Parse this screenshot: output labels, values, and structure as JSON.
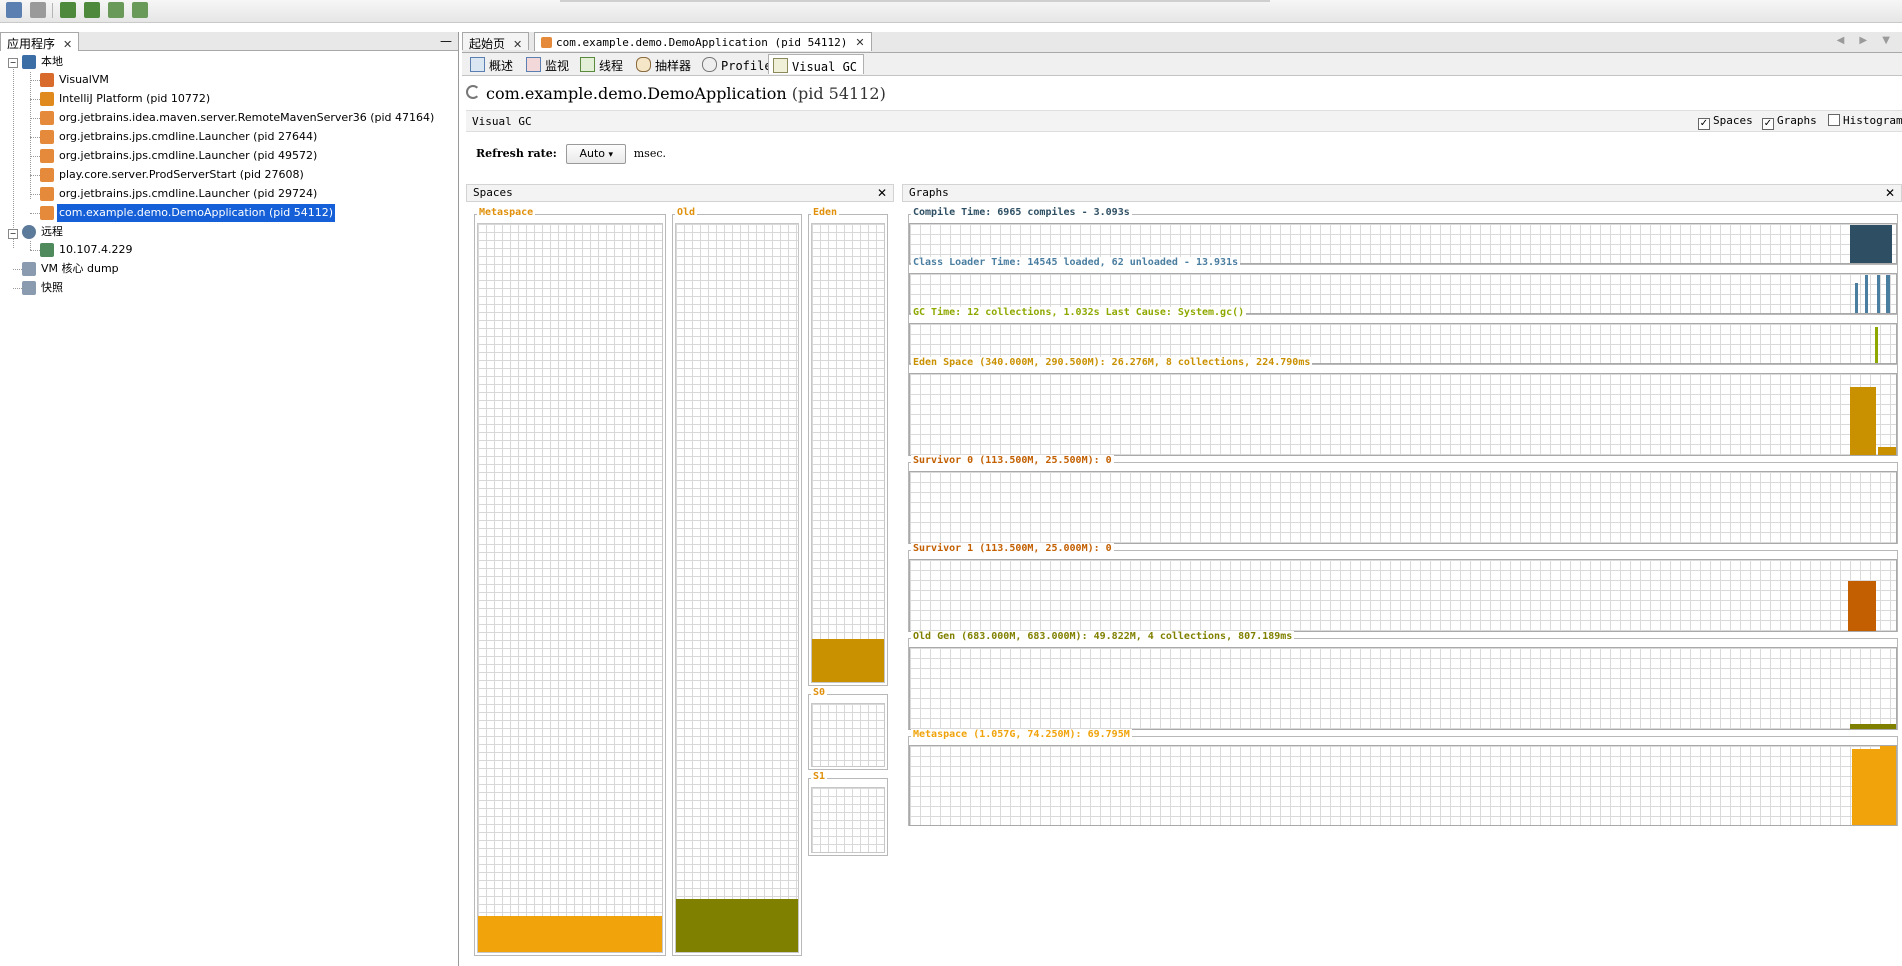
{
  "toolbar": {
    "buttons": [
      "open-snapshot-icon",
      "save-icon",
      "add-jmx-icon",
      "add-remote-host-icon",
      "add-coredump-icon",
      "load-snapshot-icon"
    ]
  },
  "left_panel": {
    "tab_label": "应用程序",
    "tree": {
      "local": {
        "label": "本地",
        "items": [
          {
            "label": "VisualVM",
            "icon": "visualvm-icon"
          },
          {
            "label": "IntelliJ Platform (pid 10772)",
            "icon": "intellij-icon"
          },
          {
            "label": "org.jetbrains.idea.maven.server.RemoteMavenServer36 (pid 47164)",
            "icon": "java-icon"
          },
          {
            "label": "org.jetbrains.jps.cmdline.Launcher (pid 27644)",
            "icon": "java-icon"
          },
          {
            "label": "org.jetbrains.jps.cmdline.Launcher (pid 49572)",
            "icon": "java-icon"
          },
          {
            "label": "play.core.server.ProdServerStart (pid 27608)",
            "icon": "java-icon"
          },
          {
            "label": "org.jetbrains.jps.cmdline.Launcher (pid 29724)",
            "icon": "java-icon"
          },
          {
            "label": "com.example.demo.DemoApplication (pid 54112)",
            "icon": "java-icon",
            "selected": true
          }
        ]
      },
      "remote": {
        "label": "远程",
        "items": [
          {
            "label": "10.107.4.229",
            "icon": "remote-host-icon"
          }
        ]
      },
      "coredump": {
        "label": "VM 核心 dump"
      },
      "snapshots": {
        "label": "快照"
      }
    }
  },
  "right_panel": {
    "tabs": [
      {
        "label": "起始页"
      },
      {
        "label": "com.example.demo.DemoApplication (pid 54112)",
        "active": true
      }
    ],
    "subtabs": [
      {
        "label": "概述",
        "icon": "overview-icon"
      },
      {
        "label": "监视",
        "icon": "monitor-icon"
      },
      {
        "label": "线程",
        "icon": "threads-icon"
      },
      {
        "label": "抽样器",
        "icon": "sampler-icon"
      },
      {
        "label": "Profiler",
        "icon": "profiler-icon"
      },
      {
        "label": "Visual GC",
        "icon": "visualgc-icon",
        "active": true
      }
    ],
    "title": {
      "app": "com.example.demo.DemoApplication",
      "pid": "(pid 54112)"
    },
    "visual_gc": {
      "header_label": "Visual GC",
      "checkboxes": [
        {
          "label": "Spaces",
          "checked": true
        },
        {
          "label": "Graphs",
          "checked": true
        },
        {
          "label": "Histogram",
          "checked": false
        }
      ],
      "refresh": {
        "label": "Refresh rate:",
        "value": "Auto",
        "unit": "msec."
      },
      "spaces": {
        "title": "Spaces",
        "metaspace": {
          "label": "Metaspace",
          "fill": 0.05,
          "color": "#f0a30a"
        },
        "old": {
          "label": "Old",
          "fill": 0.073,
          "color": "#808000"
        },
        "eden": {
          "label": "Eden",
          "fill": 0.093,
          "color": "#c99000"
        },
        "s0": {
          "label": "S0",
          "fill": 0.0
        },
        "s1": {
          "label": "S1",
          "fill": 0.0
        }
      },
      "graphs": {
        "title": "Graphs",
        "rows": [
          {
            "label": "Compile Time: 6965 compiles - 3.093s",
            "color": "#2e4f63"
          },
          {
            "label": "Class Loader Time: 14545 loaded, 62 unloaded - 13.931s",
            "color": "#4a7ea0"
          },
          {
            "label": "GC Time: 12 collections, 1.032s  Last Cause: System.gc()",
            "color": "#8fa800"
          },
          {
            "label": "Eden Space (340.000M, 290.500M): 26.276M, 8 collections, 224.790ms",
            "color": "#c99000"
          },
          {
            "label": "Survivor 0 (113.500M, 25.500M): 0",
            "color": "#c35f00"
          },
          {
            "label": "Survivor 1 (113.500M, 25.000M): 0",
            "color": "#c35f00"
          },
          {
            "label": "Old Gen (683.000M, 683.000M): 49.822M, 4 collections, 807.189ms",
            "color": "#808000"
          },
          {
            "label": "Metaspace (1.057G, 74.250M): 69.795M",
            "color": "#f0a30a"
          }
        ]
      }
    }
  }
}
